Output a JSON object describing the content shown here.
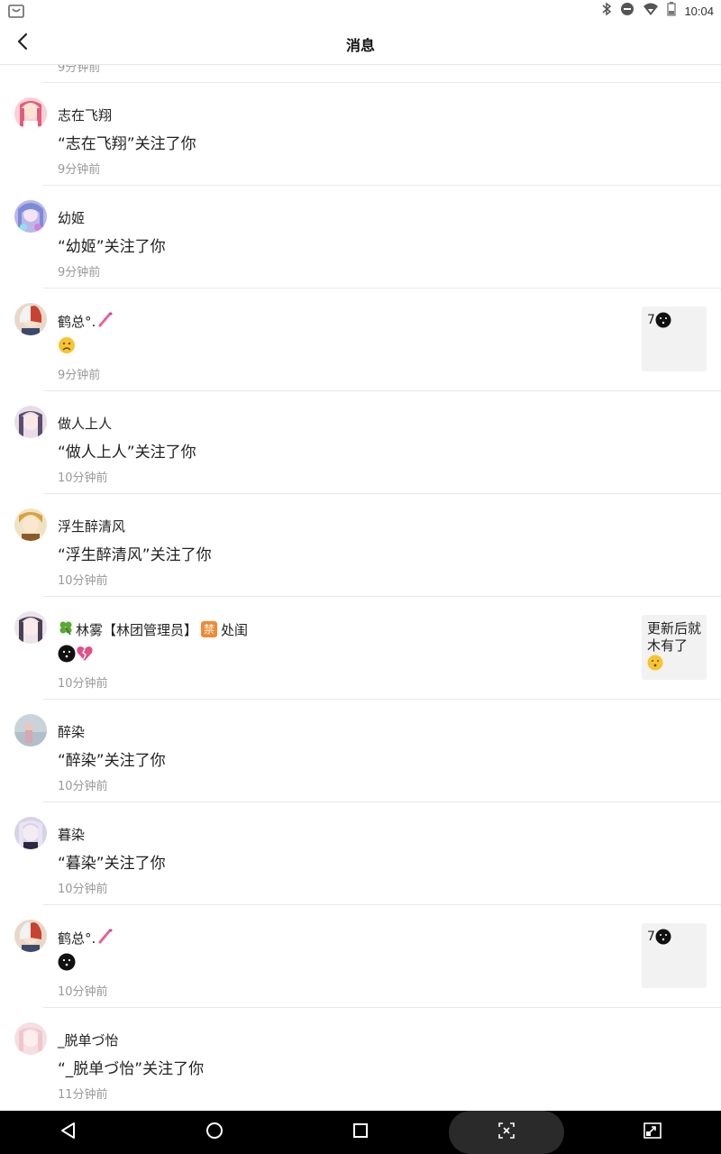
{
  "status_bar": {
    "time": "10:04",
    "left_icon": "shopping-bag-icon",
    "right_icons": [
      "bluetooth-icon",
      "do-not-disturb-icon",
      "wifi-icon",
      "battery-icon"
    ]
  },
  "header": {
    "title": "消息",
    "back_icon": "back-arrow-icon"
  },
  "partial_time": "9分钟前",
  "items": [
    {
      "name": "志在飞翔",
      "message": "“志在飞翔”关注了你",
      "time": "9分钟前"
    },
    {
      "name": "幼姬",
      "message": "“幼姬”关注了你",
      "time": "9分钟前"
    },
    {
      "name": "鹤总°.",
      "name_emoji": "pink-sparkle",
      "message": "",
      "message_emoji": [
        "frowning-face"
      ],
      "time": "9分钟前",
      "thumb_text": "7",
      "thumb_emoji": "dark-face"
    },
    {
      "name": "做人上人",
      "message": "“做人上人”关注了你",
      "time": "10分钟前"
    },
    {
      "name": "浮生醉清风",
      "message": "“浮生醉清风”关注了你",
      "time": "10分钟前"
    },
    {
      "name_prefix_emoji": "four-leaf-clover",
      "name": "林雾【林团管理员】",
      "name_badge": "禁",
      "name_suffix": "处闺",
      "message": "",
      "message_emoji": [
        "dark-face",
        "broken-heart"
      ],
      "time": "10分钟前",
      "thumb_text": "更新后就木有了",
      "thumb_emoji": "kissing-face"
    },
    {
      "name": "醉染",
      "message": "“醉染”关注了你",
      "time": "10分钟前"
    },
    {
      "name": "暮染",
      "message": "“暮染”关注了你",
      "time": "10分钟前"
    },
    {
      "name": "鹤总°.",
      "name_emoji": "pink-sparkle",
      "message": "",
      "message_emoji": [
        "dark-face"
      ],
      "time": "10分钟前",
      "thumb_text": "7",
      "thumb_emoji": "dark-face"
    },
    {
      "name": "_脱单づ怡",
      "message": "“_脱单づ怡”关注了你",
      "time": "11分钟前"
    }
  ],
  "nav_bar": {
    "back": "nav-back-icon",
    "home": "nav-home-icon",
    "recents": "nav-recents-icon",
    "screenshot": "screen-capture-icon",
    "rotate": "rotate-screen-icon"
  }
}
